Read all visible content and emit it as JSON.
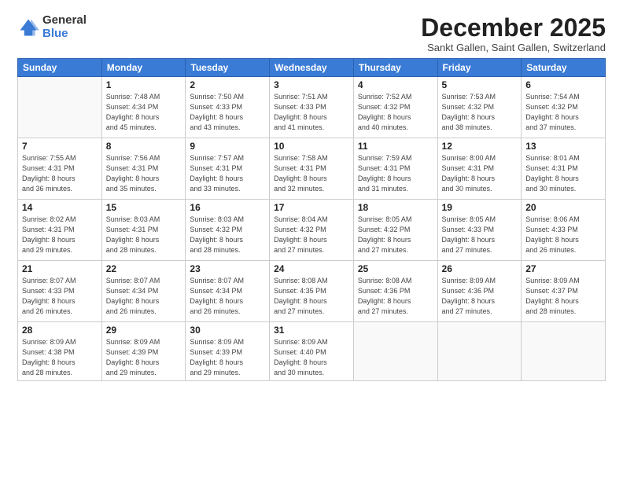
{
  "logo": {
    "general": "General",
    "blue": "Blue"
  },
  "title": "December 2025",
  "subtitle": "Sankt Gallen, Saint Gallen, Switzerland",
  "days_header": [
    "Sunday",
    "Monday",
    "Tuesday",
    "Wednesday",
    "Thursday",
    "Friday",
    "Saturday"
  ],
  "weeks": [
    [
      {
        "day": "",
        "info": ""
      },
      {
        "day": "1",
        "info": "Sunrise: 7:48 AM\nSunset: 4:34 PM\nDaylight: 8 hours\nand 45 minutes."
      },
      {
        "day": "2",
        "info": "Sunrise: 7:50 AM\nSunset: 4:33 PM\nDaylight: 8 hours\nand 43 minutes."
      },
      {
        "day": "3",
        "info": "Sunrise: 7:51 AM\nSunset: 4:33 PM\nDaylight: 8 hours\nand 41 minutes."
      },
      {
        "day": "4",
        "info": "Sunrise: 7:52 AM\nSunset: 4:32 PM\nDaylight: 8 hours\nand 40 minutes."
      },
      {
        "day": "5",
        "info": "Sunrise: 7:53 AM\nSunset: 4:32 PM\nDaylight: 8 hours\nand 38 minutes."
      },
      {
        "day": "6",
        "info": "Sunrise: 7:54 AM\nSunset: 4:32 PM\nDaylight: 8 hours\nand 37 minutes."
      }
    ],
    [
      {
        "day": "7",
        "info": "Sunrise: 7:55 AM\nSunset: 4:31 PM\nDaylight: 8 hours\nand 36 minutes."
      },
      {
        "day": "8",
        "info": "Sunrise: 7:56 AM\nSunset: 4:31 PM\nDaylight: 8 hours\nand 35 minutes."
      },
      {
        "day": "9",
        "info": "Sunrise: 7:57 AM\nSunset: 4:31 PM\nDaylight: 8 hours\nand 33 minutes."
      },
      {
        "day": "10",
        "info": "Sunrise: 7:58 AM\nSunset: 4:31 PM\nDaylight: 8 hours\nand 32 minutes."
      },
      {
        "day": "11",
        "info": "Sunrise: 7:59 AM\nSunset: 4:31 PM\nDaylight: 8 hours\nand 31 minutes."
      },
      {
        "day": "12",
        "info": "Sunrise: 8:00 AM\nSunset: 4:31 PM\nDaylight: 8 hours\nand 30 minutes."
      },
      {
        "day": "13",
        "info": "Sunrise: 8:01 AM\nSunset: 4:31 PM\nDaylight: 8 hours\nand 30 minutes."
      }
    ],
    [
      {
        "day": "14",
        "info": "Sunrise: 8:02 AM\nSunset: 4:31 PM\nDaylight: 8 hours\nand 29 minutes."
      },
      {
        "day": "15",
        "info": "Sunrise: 8:03 AM\nSunset: 4:31 PM\nDaylight: 8 hours\nand 28 minutes."
      },
      {
        "day": "16",
        "info": "Sunrise: 8:03 AM\nSunset: 4:32 PM\nDaylight: 8 hours\nand 28 minutes."
      },
      {
        "day": "17",
        "info": "Sunrise: 8:04 AM\nSunset: 4:32 PM\nDaylight: 8 hours\nand 27 minutes."
      },
      {
        "day": "18",
        "info": "Sunrise: 8:05 AM\nSunset: 4:32 PM\nDaylight: 8 hours\nand 27 minutes."
      },
      {
        "day": "19",
        "info": "Sunrise: 8:05 AM\nSunset: 4:33 PM\nDaylight: 8 hours\nand 27 minutes."
      },
      {
        "day": "20",
        "info": "Sunrise: 8:06 AM\nSunset: 4:33 PM\nDaylight: 8 hours\nand 26 minutes."
      }
    ],
    [
      {
        "day": "21",
        "info": "Sunrise: 8:07 AM\nSunset: 4:33 PM\nDaylight: 8 hours\nand 26 minutes."
      },
      {
        "day": "22",
        "info": "Sunrise: 8:07 AM\nSunset: 4:34 PM\nDaylight: 8 hours\nand 26 minutes."
      },
      {
        "day": "23",
        "info": "Sunrise: 8:07 AM\nSunset: 4:34 PM\nDaylight: 8 hours\nand 26 minutes."
      },
      {
        "day": "24",
        "info": "Sunrise: 8:08 AM\nSunset: 4:35 PM\nDaylight: 8 hours\nand 27 minutes."
      },
      {
        "day": "25",
        "info": "Sunrise: 8:08 AM\nSunset: 4:36 PM\nDaylight: 8 hours\nand 27 minutes."
      },
      {
        "day": "26",
        "info": "Sunrise: 8:09 AM\nSunset: 4:36 PM\nDaylight: 8 hours\nand 27 minutes."
      },
      {
        "day": "27",
        "info": "Sunrise: 8:09 AM\nSunset: 4:37 PM\nDaylight: 8 hours\nand 28 minutes."
      }
    ],
    [
      {
        "day": "28",
        "info": "Sunrise: 8:09 AM\nSunset: 4:38 PM\nDaylight: 8 hours\nand 28 minutes."
      },
      {
        "day": "29",
        "info": "Sunrise: 8:09 AM\nSunset: 4:39 PM\nDaylight: 8 hours\nand 29 minutes."
      },
      {
        "day": "30",
        "info": "Sunrise: 8:09 AM\nSunset: 4:39 PM\nDaylight: 8 hours\nand 29 minutes."
      },
      {
        "day": "31",
        "info": "Sunrise: 8:09 AM\nSunset: 4:40 PM\nDaylight: 8 hours\nand 30 minutes."
      },
      {
        "day": "",
        "info": ""
      },
      {
        "day": "",
        "info": ""
      },
      {
        "day": "",
        "info": ""
      }
    ]
  ]
}
